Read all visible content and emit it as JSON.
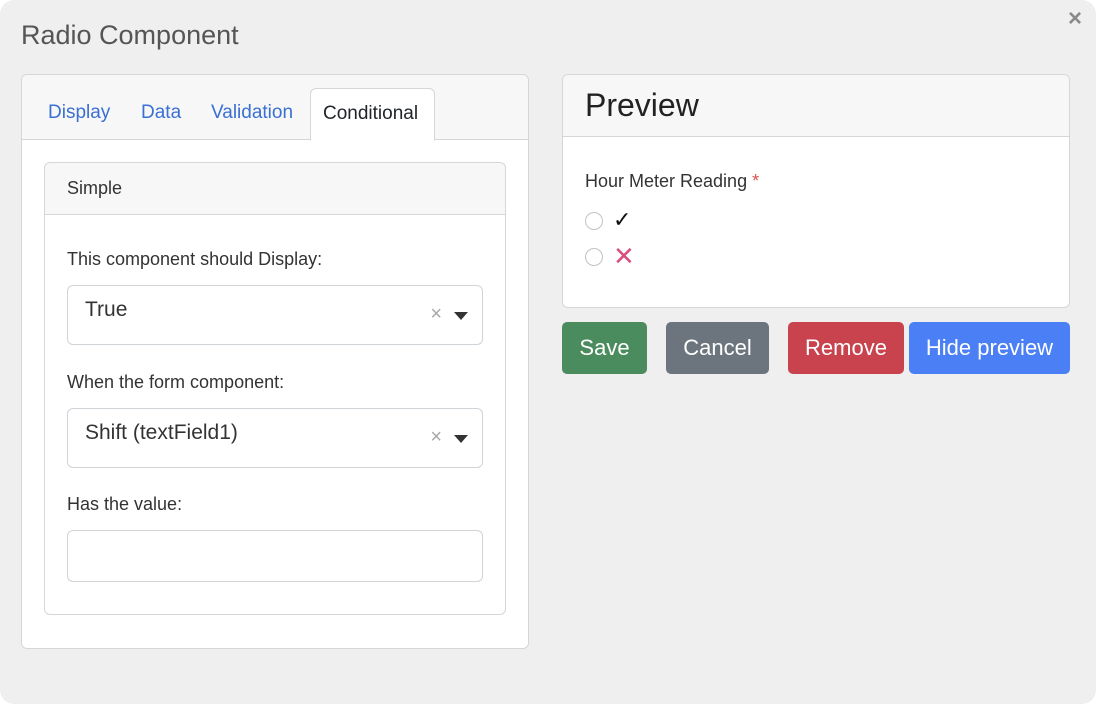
{
  "dialog": {
    "title": "Radio Component",
    "close_label": "×"
  },
  "tabs": [
    {
      "label": "Display"
    },
    {
      "label": "Data"
    },
    {
      "label": "Validation"
    },
    {
      "label": "Conditional",
      "active": true
    }
  ],
  "conditional": {
    "section_title": "Simple",
    "display_label": "This component should Display:",
    "display_value": "True",
    "component_label": "When the form component:",
    "component_value": "Shift (textField1)",
    "value_label": "Has the value:",
    "value_input": "",
    "clear_symbol": "×"
  },
  "preview": {
    "title": "Preview",
    "field_label": "Hour Meter Reading",
    "required_mark": "*",
    "options": [
      {
        "label": "✓",
        "icon": "check-icon"
      },
      {
        "label": "✕",
        "icon": "cross-icon"
      }
    ]
  },
  "buttons": {
    "save": "Save",
    "cancel": "Cancel",
    "remove": "Remove",
    "hide_preview": "Hide preview"
  },
  "colors": {
    "save": "#4b8c5f",
    "cancel": "#6c757d",
    "remove": "#c9434e",
    "hide_preview": "#4a7ff5",
    "tab_link": "#3a6fd3",
    "required": "#d9534f",
    "cross_option": "#d94f7a"
  }
}
